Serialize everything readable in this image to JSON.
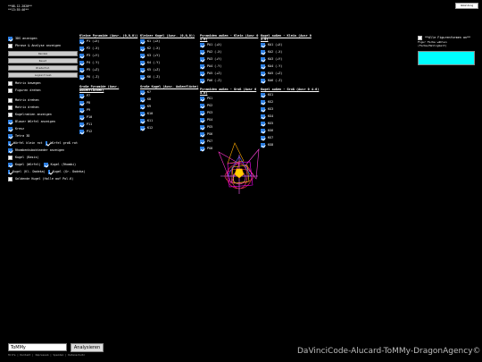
{
  "header": {
    "line1": "**08.12.2020**",
    "line2": "**13:55:46**",
    "top_button": "Abmeldung"
  },
  "left_panel": {
    "items_a": [
      {
        "label": "3DS anzeigen",
        "checked": true
      },
      {
        "label": "Phrase & Analyse anzeigen",
        "checked": false
      }
    ],
    "buttons": [
      "Random",
      "Reset",
      "Wiederhol",
      "Logzeitraum"
    ],
    "items_b": [
      {
        "label": "Matrix bewegen",
        "checked": false
      },
      {
        "label": "Figuren drehen",
        "checked": false
      }
    ],
    "items_c": [
      {
        "label": "Matrix drehen",
        "checked": false
      },
      {
        "label": "Matrix drehen",
        "checked": false
      },
      {
        "label": "Kugelradien anzeigen",
        "checked": false
      },
      {
        "label": "Blauer Würfel anzeigen",
        "checked": true
      },
      {
        "label": "Kreuz",
        "checked": true
      },
      {
        "label": "Tetra 3D",
        "checked": true
      }
    ],
    "pair1": [
      {
        "label": "Würfel klein rot",
        "checked": true
      },
      {
        "label": "Würfel groß rot",
        "checked": true
      }
    ],
    "items_d": [
      {
        "label": "Rhombenkuboktaeder anzeigen",
        "checked": true
      },
      {
        "label": "Kugel (Basis)",
        "checked": false
      }
    ],
    "pair2": [
      {
        "label": "Kugel (Würfel)",
        "checked": true
      },
      {
        "label": "Kugel (Rhombi)",
        "checked": true
      }
    ],
    "pair3": [
      {
        "label": "Kugel (Kl. Dodeka)",
        "checked": true
      },
      {
        "label": "Kugel (Gr. Dodeka)",
        "checked": true
      }
    ],
    "items_e": [
      {
        "label": "Goldende Kugel (Holle auf Pol.6)",
        "checked": false
      }
    ]
  },
  "columns": [
    {
      "title": "Kleine Pyramide (Ausr. (0,0,0))",
      "items": [
        "P1 (+X)",
        "P2 (-X)",
        "P3 (+Y)",
        "P4 (-Y)",
        "P5 (+Z)",
        "P6 (-Z)"
      ]
    },
    {
      "title": "Kleiner Kugel (Ausr. (0,0,0))",
      "items": [
        "K1 (+X)",
        "K2 (-X)",
        "K3 (+Y)",
        "K4 (-Y)",
        "K5 (+Z)",
        "K6 (-Z)"
      ]
    },
    {
      "title": "Pyramiden außen - Klein (Ausr 0 1.0)",
      "items": [
        "PA1 (+X)",
        "PA2 (-X)",
        "PA3 (+Y)",
        "PA4 (-Y)",
        "PA5 (+Z)",
        "PA6 (-Z)"
      ]
    },
    {
      "title": "Kugel außen - Klein (Ausr 0 1.0)",
      "items": [
        "KA1 (+X)",
        "KA2 (-X)",
        "KA3 (+Y)",
        "KA4 (-Y)",
        "KA5 (+Z)",
        "KA6 (-Z)"
      ]
    }
  ],
  "columns2": [
    {
      "title": "Große Pyramide (Ausr. Außenflächen)",
      "items": [
        "P7",
        "P8",
        "P9",
        "P10",
        "P11",
        "P12"
      ]
    },
    {
      "title": "Große Kugel (Ausr. Außenfläche)",
      "items": [
        "K7",
        "K8",
        "K9",
        "K10",
        "K11",
        "K12"
      ]
    },
    {
      "title": "Pyramiden außen - Groß (Ausr 0 4.0)",
      "items": [
        "PG1",
        "PG2",
        "PG3",
        "PG4",
        "PG5",
        "PG6",
        "PG7",
        "PG8"
      ]
    },
    {
      "title": "Kugel außen - Groß (Ausr 0 4.0)",
      "items": [
        "KG1",
        "KG2",
        "KG3",
        "KG4",
        "KG5",
        "KG6",
        "KG7",
        "KG8"
      ]
    }
  ],
  "right_panel": {
    "checkbox_label": "**Alle Figurenformen an**",
    "field_label": "Figur Farbe wählen (Farbe/Helligkeit)",
    "color": "#00ffff"
  },
  "bottom": {
    "input_value": "ToMMy",
    "analyze_label": "Analysieren",
    "links": "Hilfe | Kontakt | Impressum | Spenden | Datenschutz",
    "footer": "DaVinciCode-Alucard-ToMMy-DragonAgency©"
  }
}
